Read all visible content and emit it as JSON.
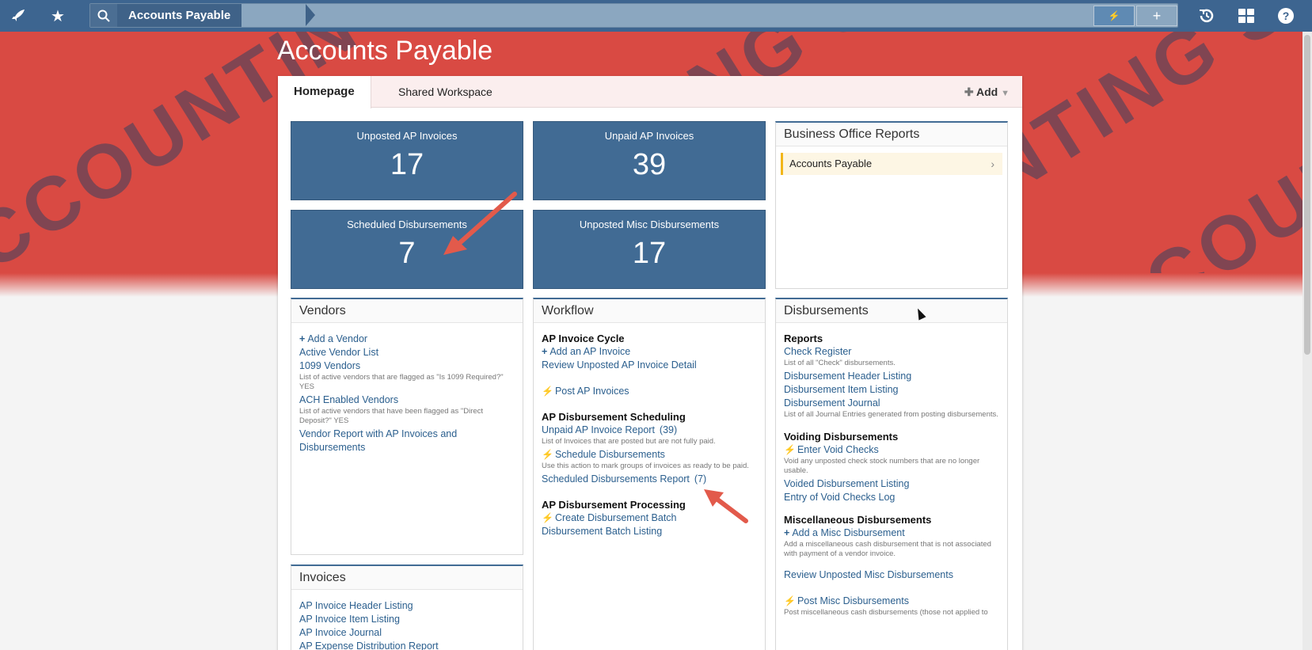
{
  "topbar": {
    "rocket_icon": "rocket-icon",
    "star_icon": "star-icon",
    "breadcrumb_label": "Accounts Payable",
    "right_icons": [
      "history-icon",
      "grid-icon",
      "help-icon"
    ]
  },
  "banner": {
    "watermark": "ACCOUNTING SANDBOX",
    "color": "#d94a43"
  },
  "page": {
    "title": "Accounts Payable"
  },
  "tabs": {
    "homepage": "Homepage",
    "shared": "Shared Workspace",
    "add": "Add"
  },
  "tiles": [
    {
      "label": "Unposted AP Invoices",
      "value": "17"
    },
    {
      "label": "Unpaid AP Invoices",
      "value": "39"
    },
    {
      "label": "Scheduled Disbursements",
      "value": "7"
    },
    {
      "label": "Unposted Misc Disbursements",
      "value": "17"
    }
  ],
  "reports_panel": {
    "title": "Business Office Reports",
    "items": [
      "Accounts Payable"
    ]
  },
  "vendors": {
    "title": "Vendors",
    "add_vendor": "Add a Vendor",
    "active_list": "Active Vendor List",
    "v1099": "1099 Vendors",
    "v1099_desc": "List of active vendors that are flagged as \"Is 1099 Required?\" YES",
    "ach": "ACH Enabled Vendors",
    "ach_desc": "List of active vendors that have been flagged as \"Direct Deposit?\" YES",
    "report": "Vendor Report with AP Invoices and Disbursements"
  },
  "invoices": {
    "title": "Invoices",
    "items": [
      "AP Invoice Header Listing",
      "AP Invoice Item Listing",
      "AP Invoice Journal",
      "AP Expense Distribution Report"
    ]
  },
  "workflow": {
    "title": "Workflow",
    "cycle_title": "AP Invoice Cycle",
    "add_invoice": "Add an AP Invoice",
    "review_unposted": "Review Unposted AP Invoice Detail",
    "post_invoices": "Post AP Invoices",
    "sched_title": "AP Disbursement Scheduling",
    "unpaid_report": "Unpaid AP Invoice Report",
    "unpaid_count": "(39)",
    "unpaid_desc": "List of Invoices that are posted but are not fully paid.",
    "schedule": "Schedule Disbursements",
    "schedule_desc": "Use this action to mark groups of invoices as ready to be paid.",
    "sched_report": "Scheduled Disbursements Report",
    "sched_count": "(7)",
    "proc_title": "AP Disbursement Processing",
    "create_batch": "Create Disbursement Batch",
    "batch_listing": "Disbursement Batch Listing"
  },
  "disbursements": {
    "title": "Disbursements",
    "reports_title": "Reports",
    "check_register": "Check Register",
    "check_desc": "List of all \"Check\" disbursements.",
    "header_listing": "Disbursement Header Listing",
    "item_listing": "Disbursement Item Listing",
    "journal": "Disbursement Journal",
    "journal_desc": "List of all Journal Entries generated from posting disbursements.",
    "void_title": "Voiding Disbursements",
    "enter_void": "Enter Void Checks",
    "void_desc": "Void any unposted check stock numbers that are no longer usable.",
    "voided_listing": "Voided Disbursement Listing",
    "void_log": "Entry of Void Checks Log",
    "misc_title": "Miscellaneous Disbursements",
    "add_misc": "Add a Misc Disbursement",
    "misc_desc": "Add a miscellaneous cash disbursement that is not associated with payment of a vendor invoice.",
    "review_misc": "Review Unposted Misc Disbursements",
    "post_misc": "Post Misc Disbursements",
    "post_misc_desc": "Post miscellaneous cash disbursements (those not applied to"
  }
}
